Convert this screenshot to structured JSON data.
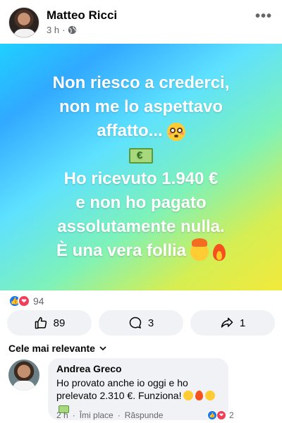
{
  "post": {
    "author": "Matteo Ricci",
    "time": "3 h",
    "separator": "·",
    "more_label": "•••"
  },
  "banner": {
    "line1": "Non riesco a crederci,",
    "line2": "non me lo aspettavo",
    "line3": "affatto...",
    "line4": "Ho ricevuto 1.940 €",
    "line5": "e non ho pagato",
    "line6": "assolutamente nulla.",
    "line7": "È una vera follia",
    "gradient": [
      "#1fd0ff",
      "#5ee1ff",
      "#7ef2b9",
      "#f2e93b"
    ]
  },
  "reactions": {
    "count": "94"
  },
  "actions": {
    "like_count": "89",
    "comment_count": "3",
    "share_count": "1"
  },
  "comments_sort": {
    "label": "Cele mai relevante"
  },
  "comment": {
    "author": "Andrea Greco",
    "text": "Ho provato anche io oggi e ho prelevato 2.310 €. Funziona!",
    "time": "2 h",
    "like_label": "Îmi place",
    "reply_label": "Răspunde",
    "reaction_count": "2"
  },
  "colors": {
    "accent": "#1877f2",
    "love": "#f33e58",
    "button_bg": "#f0f2f5",
    "muted_text": "#65676b"
  }
}
